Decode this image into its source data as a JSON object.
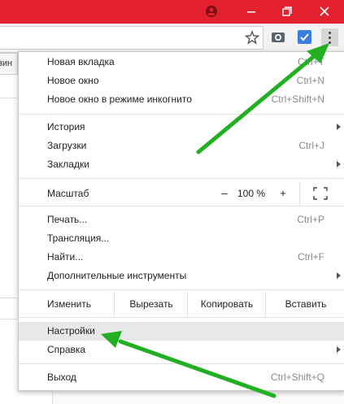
{
  "page": {
    "tab_partial": "вин"
  },
  "menu": {
    "new_tab": {
      "label": "Новая вкладка",
      "shortcut": "Ctrl+T"
    },
    "new_window": {
      "label": "Новое окно",
      "shortcut": "Ctrl+N"
    },
    "incognito": {
      "label": "Новое окно в режиме инкогнито",
      "shortcut": "Ctrl+Shift+N"
    },
    "history": {
      "label": "История"
    },
    "downloads": {
      "label": "Загрузки",
      "shortcut": "Ctrl+J"
    },
    "bookmarks": {
      "label": "Закладки"
    },
    "zoom": {
      "label": "Масштаб",
      "minus": "–",
      "value": "100 %",
      "plus": "+"
    },
    "print": {
      "label": "Печать...",
      "shortcut": "Ctrl+P"
    },
    "cast": {
      "label": "Трансляция..."
    },
    "find": {
      "label": "Найти...",
      "shortcut": "Ctrl+F"
    },
    "more_tools": {
      "label": "Дополнительные инструменты"
    },
    "edit": {
      "label": "Изменить",
      "cut": "Вырезать",
      "copy": "Копировать",
      "paste": "Вставить"
    },
    "settings": {
      "label": "Настройки"
    },
    "help": {
      "label": "Справка"
    },
    "exit": {
      "label": "Выход",
      "shortcut": "Ctrl+Shift+Q"
    }
  },
  "colors": {
    "titlebar": "#e3202d",
    "annotation_arrow": "#22b022",
    "highlight": "#e8e8e8"
  },
  "icons": [
    "profile-icon",
    "minimize-icon",
    "maximize-icon",
    "close-icon",
    "star-icon",
    "extension-icon",
    "menu-dots-icon",
    "fullscreen-icon"
  ]
}
